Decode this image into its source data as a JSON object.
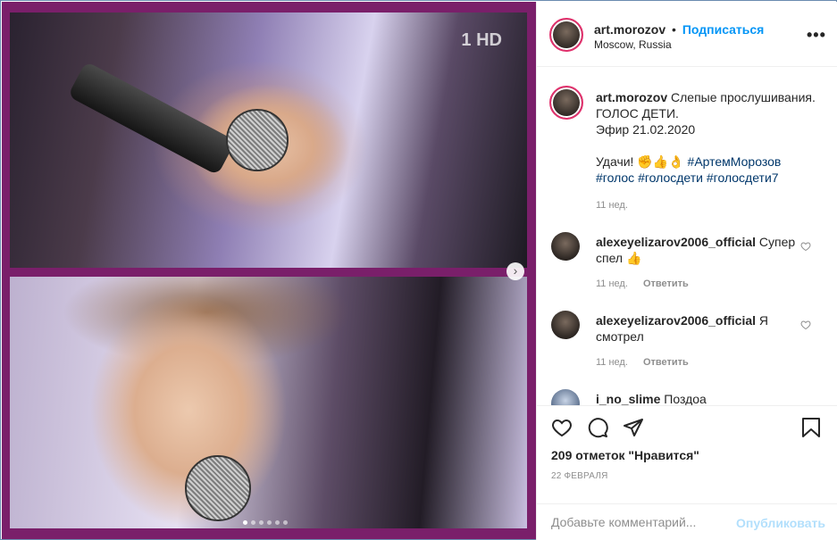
{
  "post": {
    "author": "art.morozov",
    "follow_label": "Подписаться",
    "separator": "•",
    "location": "Moscow, Russia",
    "more_label": "•••",
    "channel_logo": "1 HD",
    "carousel_next": "›",
    "carousel_dots": 6,
    "carousel_active": 0
  },
  "caption": {
    "author": "art.morozov",
    "text_1": "Слепые прослушивания.",
    "text_2": "ГОЛОС ДЕТИ.",
    "text_3": "Эфир 21.02.2020",
    "text_4": "Удачи! ✊👍👌",
    "hashtag_1": "#АртемМорозов",
    "hashtag_2": "#голос",
    "hashtag_3": "#голосдети",
    "hashtag_4": "#голосдети7",
    "time": "11 нед."
  },
  "comments": [
    {
      "author": "alexeyelizarov2006_official",
      "text": "Супер спел 👍",
      "time": "11 нед.",
      "reply": "Ответить"
    },
    {
      "author": "alexeyelizarov2006_official",
      "text": "Я смотрел",
      "time": "11 нед.",
      "reply": "Ответить"
    },
    {
      "author": "i_no_slime",
      "text": "Поздоа",
      "time": "",
      "reply": ""
    }
  ],
  "actions": {
    "likes": "209 отметок \"Нравится\"",
    "date": "22 ФЕВРАЛЯ"
  },
  "add_comment": {
    "placeholder": "Добавьте комментарий...",
    "publish": "Опубликовать"
  },
  "colors": {
    "frame_purple": "#7a1f6a",
    "link_blue": "#0095f6",
    "hashtag": "#00376b",
    "muted": "#8e8e8e"
  },
  "icons": [
    "heart-icon",
    "comment-icon",
    "share-icon",
    "bookmark-icon",
    "more-icon",
    "chevron-right-icon"
  ]
}
